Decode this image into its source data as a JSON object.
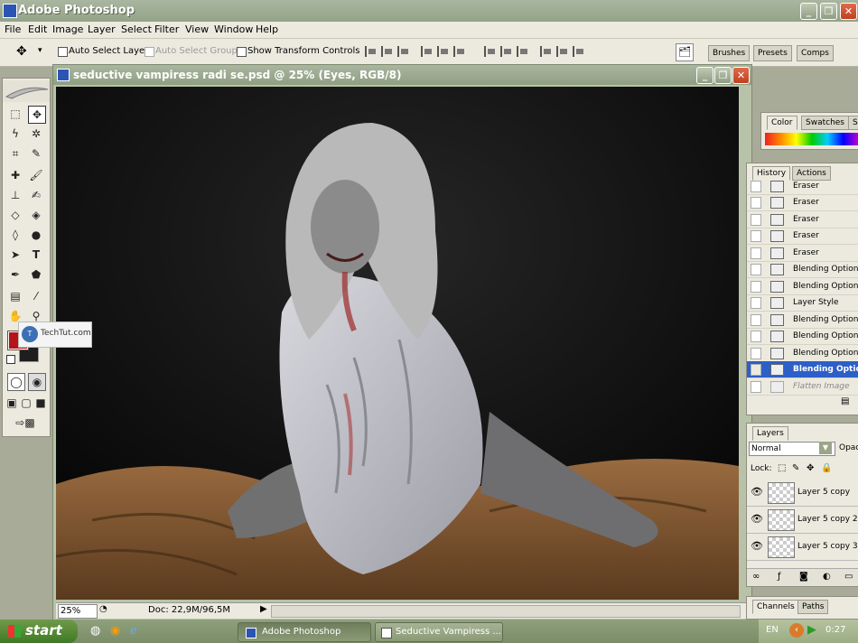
{
  "app": {
    "title": "Adobe Photoshop"
  },
  "window_controls": {
    "minimize": "_",
    "restore": "❐",
    "close": "✕"
  },
  "menu": [
    "File",
    "Edit",
    "Image",
    "Layer",
    "Select",
    "Filter",
    "View",
    "Window",
    "Help"
  ],
  "options_bar": {
    "auto_select_layer": "Auto Select Layer",
    "auto_select_groups": "Auto Select Groups",
    "show_transform_controls": "Show Transform Controls"
  },
  "palette_well": {
    "tabs": [
      "Brushes",
      "Presets",
      "Comps"
    ]
  },
  "document": {
    "title": "seductive vampiress radi se.psd @ 25% (Eyes, RGB/8)",
    "zoom": "25%",
    "doc_size": "Doc: 22,9M/96,5M"
  },
  "watermark": "TechTut.com",
  "color_panel": {
    "tabs": [
      "Color",
      "Swatches",
      "S"
    ]
  },
  "history_panel": {
    "tabs": [
      "History",
      "Actions"
    ],
    "rows": [
      {
        "label": "Eraser",
        "state": "normal"
      },
      {
        "label": "Eraser",
        "state": "normal"
      },
      {
        "label": "Eraser",
        "state": "normal"
      },
      {
        "label": "Eraser",
        "state": "normal"
      },
      {
        "label": "Eraser",
        "state": "normal"
      },
      {
        "label": "Blending Options",
        "state": "normal"
      },
      {
        "label": "Blending Options",
        "state": "normal"
      },
      {
        "label": "Layer Style",
        "state": "normal"
      },
      {
        "label": "Blending Options",
        "state": "normal"
      },
      {
        "label": "Blending Options",
        "state": "normal"
      },
      {
        "label": "Blending Options",
        "state": "normal"
      },
      {
        "label": "Blending Options",
        "state": "active"
      },
      {
        "label": "Flatten Image",
        "state": "snap"
      }
    ]
  },
  "layers_panel": {
    "tab": "Layers",
    "blend_mode": "Normal",
    "opacity_label": "Opac",
    "lock_label": "Lock:",
    "rows": [
      {
        "name": "Layer 5 copy"
      },
      {
        "name": "Layer 5 copy 2"
      },
      {
        "name": "Layer 5 copy 3"
      }
    ]
  },
  "channels_panel": {
    "tabs": [
      "Channels",
      "Paths"
    ]
  },
  "taskbar": {
    "start": "start",
    "tasks": [
      "Adobe Photoshop",
      "Seductive Vampiress ..."
    ],
    "language": "EN",
    "time": "0:27"
  },
  "colors": {
    "foreground": "#b5141b",
    "background": "#1e1e1e",
    "accent": "#2c5fc7"
  }
}
